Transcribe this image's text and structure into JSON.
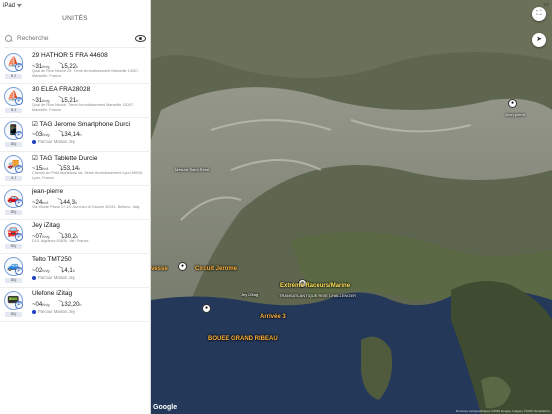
{
  "status": {
    "carrier": "iPad ᯤ",
    "battery": "▭"
  },
  "panel": {
    "title": "UNITÉS",
    "search_placeholder": "Recherche"
  },
  "units": [
    {
      "name": "29 HATHOR 5 FRA 44608",
      "speed": "31",
      "speed_unit": "Kn/g",
      "distance": "5,22",
      "distance_unit": "h",
      "addr": "Quai de Rive Neuve 25, 7ème Arrondissement\nMarseille 13007, Marseille, France",
      "badge": "5 J",
      "icon": "sailboat-icon",
      "emoji": "⛵"
    },
    {
      "name": "30 ELEA FRA28028",
      "speed": "31",
      "speed_unit": "Kn/g",
      "distance": "5,21",
      "distance_unit": "h",
      "addr": "Quai de Rive Neuve, 7ème Arrondissement\nMarseille 13007, Marseille, France",
      "badge": "5 J",
      "icon": "sailboat-icon",
      "emoji": "⛵"
    },
    {
      "name": "☑ TAG Jerome Smartphone Durci",
      "speed": "03",
      "speed_unit": "Kn/g",
      "distance": "34,14",
      "distance_unit": "h",
      "route": "Parcour Maison Jey",
      "badge": "30 j",
      "icon": "phone-icon",
      "emoji": "📱"
    },
    {
      "name": "☑ TAG Tablette Durcie",
      "speed": "15",
      "speed_unit": "Kn/l",
      "distance": "53,14",
      "distance_unit": "h",
      "addr": "Chemin du Petit Montbeau Va, 9ème Arrondissement Lyon 69009, Lyon, France",
      "badge": "4 J",
      "icon": "tablet-icon",
      "emoji": "🚚"
    },
    {
      "name": "jean-pierre",
      "speed": "24",
      "speed_unit": "Kn/l",
      "distance": "44,3",
      "distance_unit": "h",
      "addr": "Via Monte Piana 17-19, Auronzo di Cadore\n32041, Belluno, Italy",
      "badge": "30 j",
      "icon": "car-icon",
      "emoji": "🚗"
    },
    {
      "name": "Jey iZitag",
      "speed": "07",
      "speed_unit": "Kn/g",
      "distance": "30,2",
      "distance_unit": "h",
      "addr": "D10, Aiguines 83630, Var, France",
      "badge": "30 j",
      "icon": "car-icon",
      "emoji": "🚘"
    },
    {
      "name": "Telto TMT250",
      "speed": "02",
      "speed_unit": "Kn/g",
      "distance": "4,1",
      "distance_unit": "h",
      "route": "Parcour Maison Jey",
      "badge": "30 j",
      "icon": "tracker-icon",
      "emoji": "🚙"
    },
    {
      "name": "Ulefone iZitag",
      "speed": "04",
      "speed_unit": "Kn/g",
      "distance": "32,20",
      "distance_unit": "h",
      "route": "Parcour Maison Jey",
      "badge": "30 j",
      "icon": "phone-icon",
      "emoji": "📟"
    }
  ],
  "map": {
    "labels": {
      "circuit": "Circuit Jerome",
      "vesse": "vesse",
      "jey": "Jey iZitag",
      "extr": "Extrémé Raceurs/Marine",
      "challenge": "TRANSATLANTIQUE RIVE CHALLENGER",
      "arrivee": "Arrivée 3",
      "bouee": "BOUEE GRAND RIBEAU",
      "north": "Mesure Saint Remi",
      "east": "Jean-pierre"
    },
    "google": "Google",
    "copyright": "Données cartographiques ©2019 Google, Imagery ©2019 TerraMetrics"
  }
}
